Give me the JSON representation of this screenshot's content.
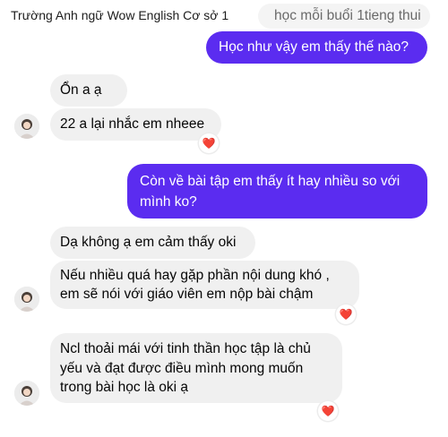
{
  "header": {
    "title": "Trường Anh ngữ Wow English Cơ sở 1"
  },
  "reaction": {
    "emoji": "❤️",
    "icon": "heart-icon",
    "color": "#e0245e"
  },
  "colors": {
    "outgoing": "#5b2cf0",
    "incoming": "#f0f0f0"
  },
  "messages": [
    {
      "sender": "other-faded",
      "lines": [
        "học mỗi buổi 1tieng thui"
      ]
    },
    {
      "sender": "me",
      "lines": [
        "Học như vậy em thấy thế nào?"
      ]
    },
    {
      "sender": "other",
      "lines": [
        "Ổn a ạ"
      ]
    },
    {
      "sender": "other",
      "lines": [
        "22 a lại nhắc em nheee"
      ],
      "reaction": "❤️"
    },
    {
      "sender": "me",
      "lines": [
        "Còn về bài tập em thấy ít hay nhiều so với",
        "mình ko?"
      ]
    },
    {
      "sender": "other",
      "lines": [
        "Dạ không ạ em cảm thấy oki"
      ]
    },
    {
      "sender": "other",
      "lines": [
        "Nếu nhiều quá hay gặp phần nội dung khó ,",
        "em sẽ nói với giáo viên em nộp bài chậm"
      ],
      "reaction": "❤️"
    },
    {
      "sender": "other",
      "lines": [
        "Ncl thoải mái với tinh thần học tập là chủ",
        "yếu và đạt được điều mình mong muốn",
        "trong bài học là oki ạ"
      ],
      "reaction": "❤️"
    }
  ]
}
